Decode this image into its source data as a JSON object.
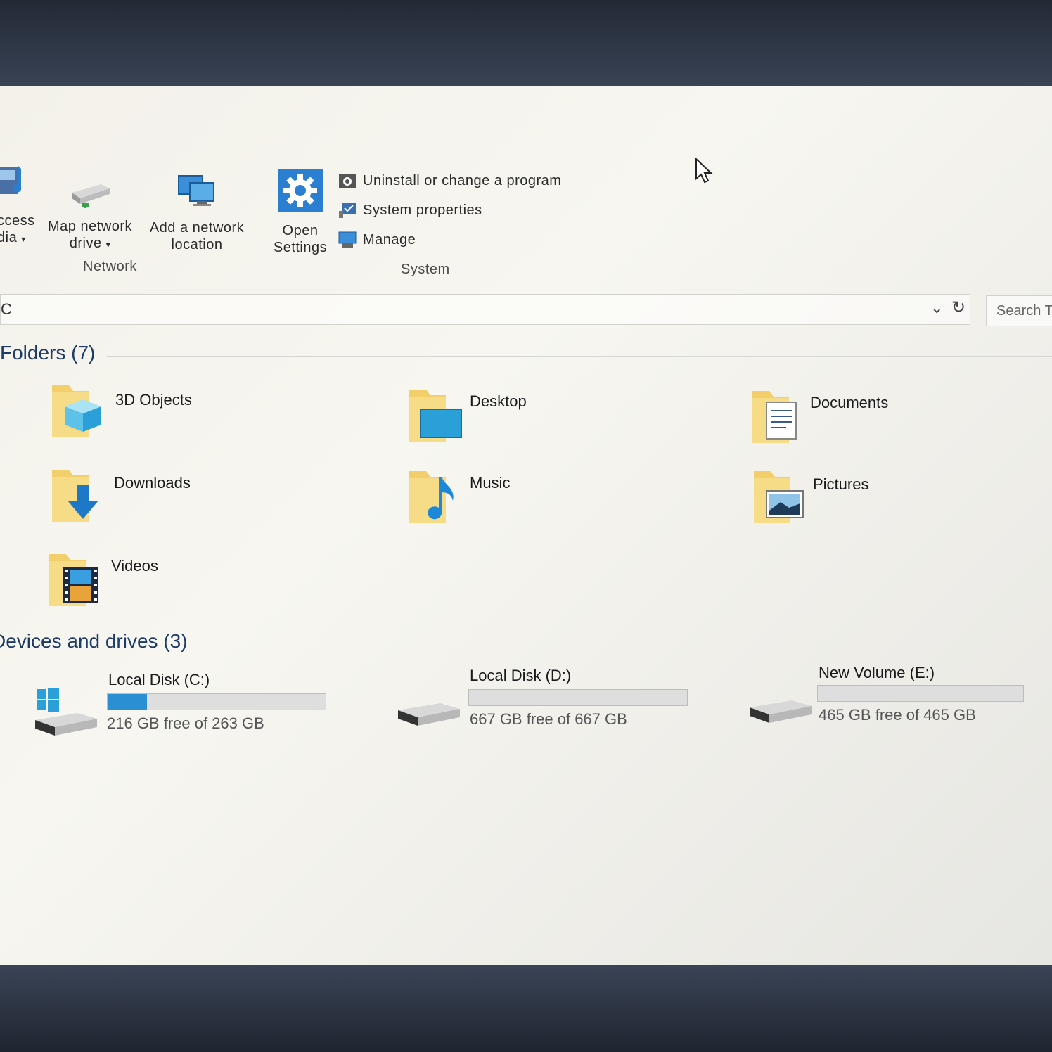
{
  "ribbon": {
    "network": {
      "group_label": "Network",
      "access_media": {
        "line1": "ccess",
        "line2": "dia"
      },
      "map_drive": {
        "line1": "Map network",
        "line2": "drive"
      },
      "add_location": {
        "line1": "Add a network",
        "line2": "location"
      }
    },
    "system": {
      "group_label": "System",
      "open_settings": {
        "line1": "Open",
        "line2": "Settings"
      },
      "uninstall": "Uninstall or change a program",
      "properties": "System properties",
      "manage": "Manage"
    }
  },
  "address": {
    "path": "C",
    "search_placeholder": "Search T"
  },
  "folders": {
    "header": "Folders (7)",
    "items": [
      {
        "label": "3D Objects"
      },
      {
        "label": "Desktop"
      },
      {
        "label": "Documents"
      },
      {
        "label": "Downloads"
      },
      {
        "label": "Music"
      },
      {
        "label": "Pictures"
      },
      {
        "label": "Videos"
      }
    ]
  },
  "drives": {
    "header": "Devices and drives (3)",
    "items": [
      {
        "label": "Local Disk (C:)",
        "free": "216 GB free of 263 GB",
        "used_fraction": 0.18
      },
      {
        "label": "Local Disk (D:)",
        "free": "667 GB free of 667 GB",
        "used_fraction": 0.0
      },
      {
        "label": "New Volume (E:)",
        "free": "465 GB free of 465 GB",
        "used_fraction": 0.0
      }
    ]
  },
  "colors": {
    "accent": "#2b8fd4",
    "header_text": "#1e3a66",
    "folder_yellow": "#f3cf6b"
  }
}
